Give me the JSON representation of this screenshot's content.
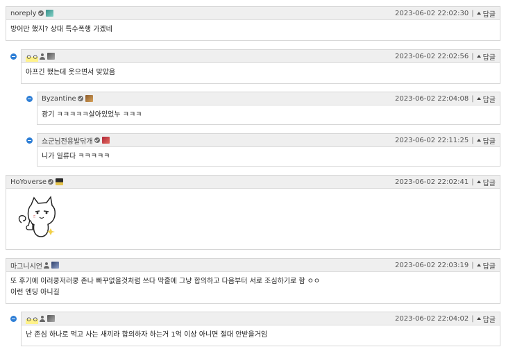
{
  "reply_label": "답글",
  "comments": [
    {
      "author": "noreply",
      "timestamp": "2023-06-02 22:02:30",
      "text": "방어만 했지? 상대 특수폭행 가겠네"
    },
    {
      "author": "ㅇㅇ",
      "timestamp": "2023-06-02 22:02:56",
      "text": "아프긴 했는데 웃으면서 맞았음"
    },
    {
      "author": "Byzantine",
      "timestamp": "2023-06-02 22:04:08",
      "text": "광기 ㅋㅋㅋㅋㅋ살아있었누 ㅋㅋㅋ"
    },
    {
      "author": "쇼군님전용발닦개",
      "timestamp": "2023-06-02 22:11:25",
      "text": "니가 일류다 ㅋㅋㅋㅋㅋ"
    },
    {
      "author": "HoYoverse",
      "timestamp": "2023-06-02 22:02:41",
      "text": ""
    },
    {
      "author": "마그니시언",
      "timestamp": "2023-06-02 22:03:19",
      "text_line1": "또 후기에 이러쿵저러쿵 존나 빠꾸없을것처럼 쓰다 막줄에 그냥 합의하고 다음부터 서로 조심하기로 함 ㅇㅇ",
      "text_line2": "이런 엔딩 아니길"
    },
    {
      "author": "ㅇㅇ",
      "timestamp": "2023-06-02 22:04:02",
      "text": "난 존심 하나로 먹고 사는 새끼라 합의하자  하는거 1억 이상 아니면 절대 안받을거임"
    }
  ],
  "colors": {
    "reply_dot": "#2f7fd6",
    "header_bg": "#efefef",
    "border": "#d6d6d6",
    "highlight": "#fff28a"
  }
}
